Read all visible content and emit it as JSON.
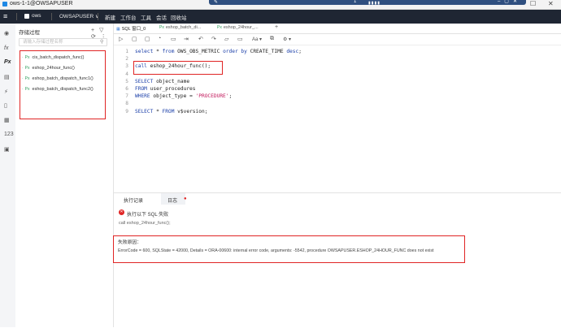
{
  "window": {
    "title": "ows-1-1@OWSAPUSER",
    "remote_bar_number": "1",
    "controls": [
      "—",
      "☐",
      "✕"
    ]
  },
  "navbar": {
    "brand": "ows",
    "user": "OWSAPUSER ∨",
    "menu": [
      "新建",
      "工作台",
      "工具",
      "会话",
      "回收站"
    ]
  },
  "panel": {
    "title": "存储过程",
    "tools": "+ ▽ ⟳ ⋮",
    "search_placeholder": "请输入存储过程名称",
    "procedures": [
      "cis_batch_dispatch_func()",
      "eshop_24hour_func()",
      "eshop_batch_dispatch_func1()",
      "eshop_batch_dispatch_func2()"
    ]
  },
  "tabs": [
    {
      "label": "SQL 窗口_0",
      "active": true
    },
    {
      "label": "eshop_batch_di...",
      "active": false
    },
    {
      "label": "eshop_24hour_...",
      "active": false
    }
  ],
  "tab_add": "+",
  "editor": {
    "lines": [
      {
        "n": "1",
        "html": "<span class='kw'>select</span> * <span class='kw'>from</span> OWS_OBS_METRIC <span class='kw'>order by</span> CREATE_TIME <span class='kw'>desc</span>;"
      },
      {
        "n": "2",
        "html": ""
      },
      {
        "n": "3",
        "html": "<span class='kw'>call</span> eshop_24hour_func();"
      },
      {
        "n": "4",
        "html": ""
      },
      {
        "n": "5",
        "html": "<span class='kw'>SELECT</span> object_name"
      },
      {
        "n": "6",
        "html": "<span class='kw'>FROM</span> user_procedures"
      },
      {
        "n": "7",
        "html": "<span class='kw'>WHERE</span> object_type = <span class='str'>'PROCEDURE'</span>;"
      },
      {
        "n": "8",
        "html": ""
      },
      {
        "n": "9",
        "html": "<span class='kw'>SELECT</span> * <span class='kw'>FROM</span> v$version;"
      }
    ]
  },
  "bottom": {
    "tab_history": "执行记录",
    "tab_log": "日志",
    "error_title": "执行以下 SQL 失败",
    "sql_call": "call eshop_24hour_func();",
    "reason_title": "失败原因：",
    "reason_text": "ErrorCode = 600, SQLState = 42000, Details = ORA-00600: internal error code, arguments: -5542, procedure OWSAPUSER.ESHOP_24HOUR_FUNC does not exist"
  },
  "colors": {
    "navbar_bg": "#1f2633",
    "annotation_red": "#e02424",
    "keyword_blue": "#1a3ea8",
    "proc_icon_green": "#2e9e5b"
  }
}
